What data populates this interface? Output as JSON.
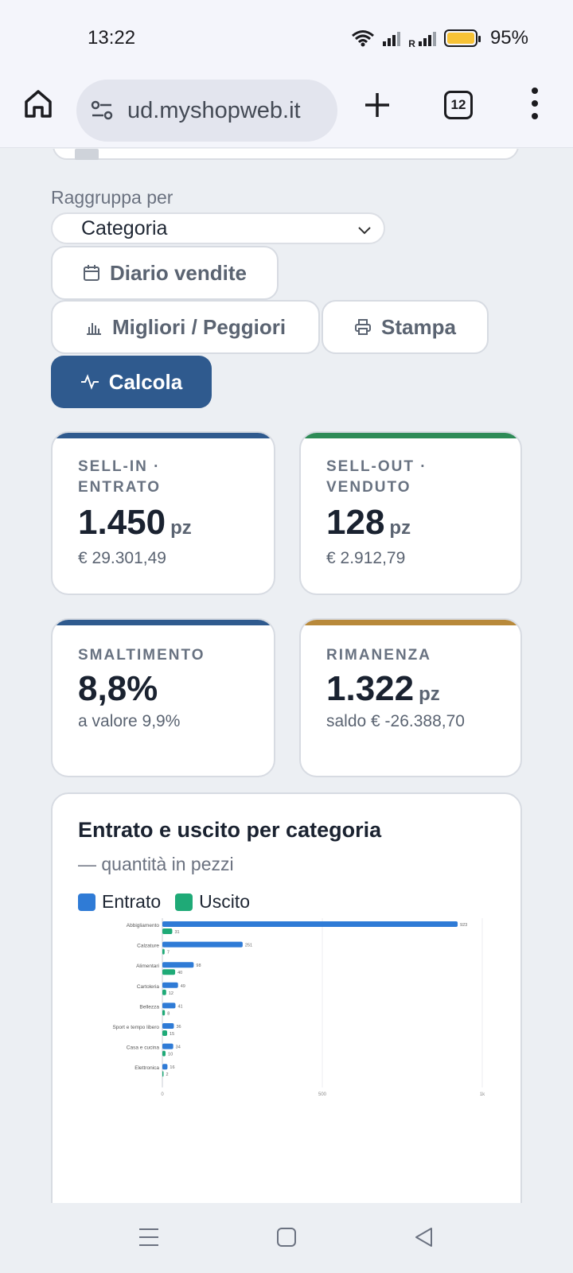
{
  "status_bar": {
    "time": "13:22",
    "carrier_r": "R",
    "battery": "95%"
  },
  "browser": {
    "url": "ud.myshopweb.it",
    "tabs_count": "12"
  },
  "filters": {
    "group_label": "Raggruppa per",
    "group_value": "Categoria"
  },
  "buttons": {
    "diario": "Diario vendite",
    "migliori": "Migliori / Peggiori",
    "stampa": "Stampa",
    "calcola": "Calcola"
  },
  "kpis": [
    {
      "label": "SELL-IN · ENTRATO",
      "value": "1.450",
      "unit": "pz",
      "sub": "€ 29.301,49",
      "accent": "#2f5a8e"
    },
    {
      "label": "SELL-OUT · VENDUTO",
      "value": "128",
      "unit": "pz",
      "sub": "€ 2.912,79",
      "accent": "#2e8b57"
    },
    {
      "label": "SMALTIMENTO",
      "value": "8,8%",
      "unit": "",
      "sub": "a valore 9,9%",
      "accent": "#2f5a8e"
    },
    {
      "label": "RIMANENZA",
      "value": "1.322",
      "unit": "pz",
      "sub": "saldo € -26.388,70",
      "accent": "#b8893a"
    }
  ],
  "chart_data": {
    "type": "bar",
    "orientation": "horizontal",
    "title": "Entrato e uscito per categoria",
    "subtitle": "— quantità in pezzi",
    "categories": [
      "Abbigliamento",
      "Calzature",
      "Alimentari",
      "Cartoleria",
      "Bellezza",
      "Sport e tempo libero",
      "Casa e cucina",
      "Elettronica"
    ],
    "series": [
      {
        "name": "Entrato",
        "color": "#2f7bd6",
        "values": [
          923,
          251,
          98,
          49,
          41,
          36,
          34,
          16
        ]
      },
      {
        "name": "Uscito",
        "color": "#1faa77",
        "values": [
          31,
          7,
          40,
          12,
          8,
          15,
          10,
          2
        ]
      }
    ],
    "xaxis_ticks": [
      "0",
      "500",
      "1k"
    ],
    "xlim": [
      0,
      1000
    ],
    "grid": true,
    "legend_position": "top-left"
  }
}
